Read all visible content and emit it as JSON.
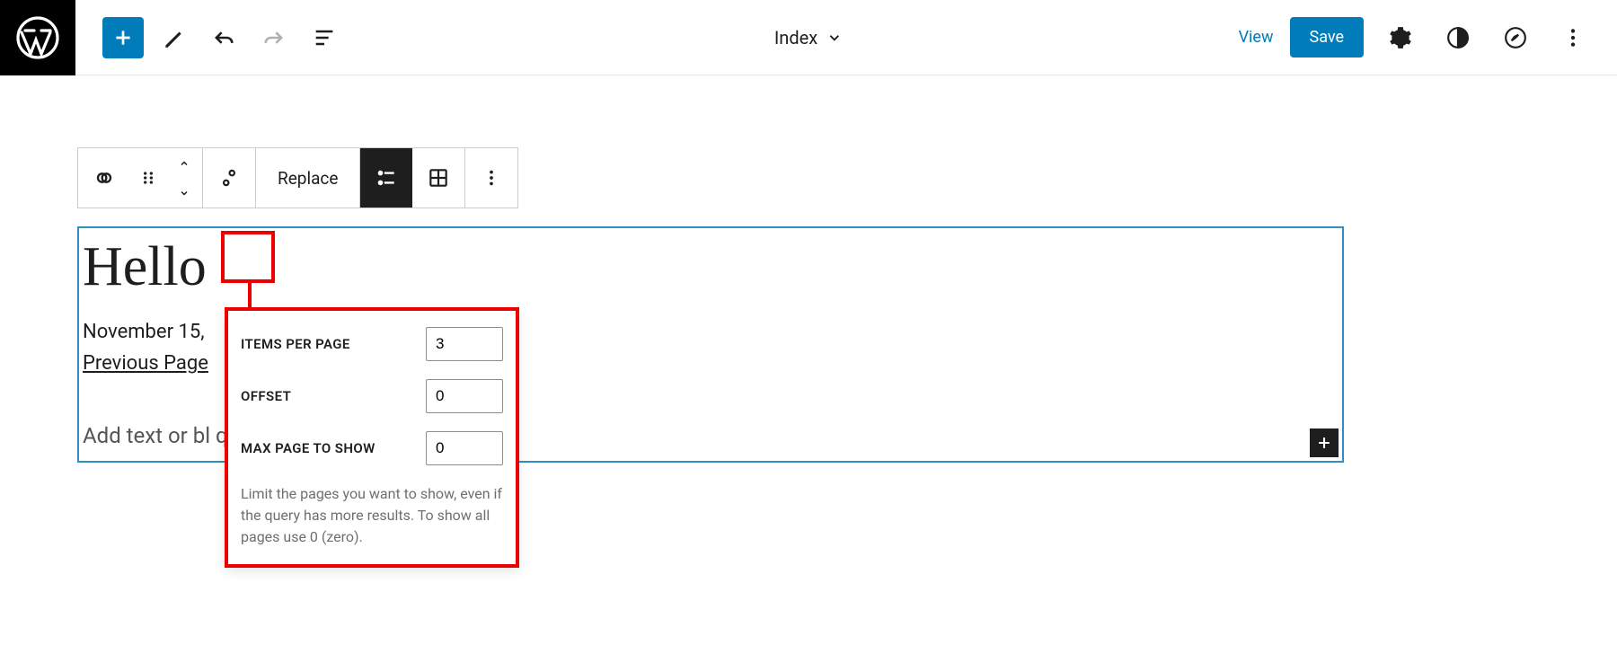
{
  "topbar": {
    "template_title": "Index",
    "view_label": "View",
    "save_label": "Save"
  },
  "block_toolbar": {
    "replace_label": "Replace"
  },
  "popover": {
    "items_per_page": {
      "label": "Items per Page",
      "value": "3"
    },
    "offset": {
      "label": "Offset",
      "value": "0"
    },
    "max_pages": {
      "label": "Max page to show",
      "value": "0"
    },
    "help_text": "Limit the pages you want to show, even if the query has more results. To show all pages use 0 (zero)."
  },
  "content": {
    "post_title": "Hello",
    "post_date": "November 15,",
    "prev_page": "Previous Page",
    "no_results_placeholder": "Add text or bl                                                         query returns no results."
  }
}
